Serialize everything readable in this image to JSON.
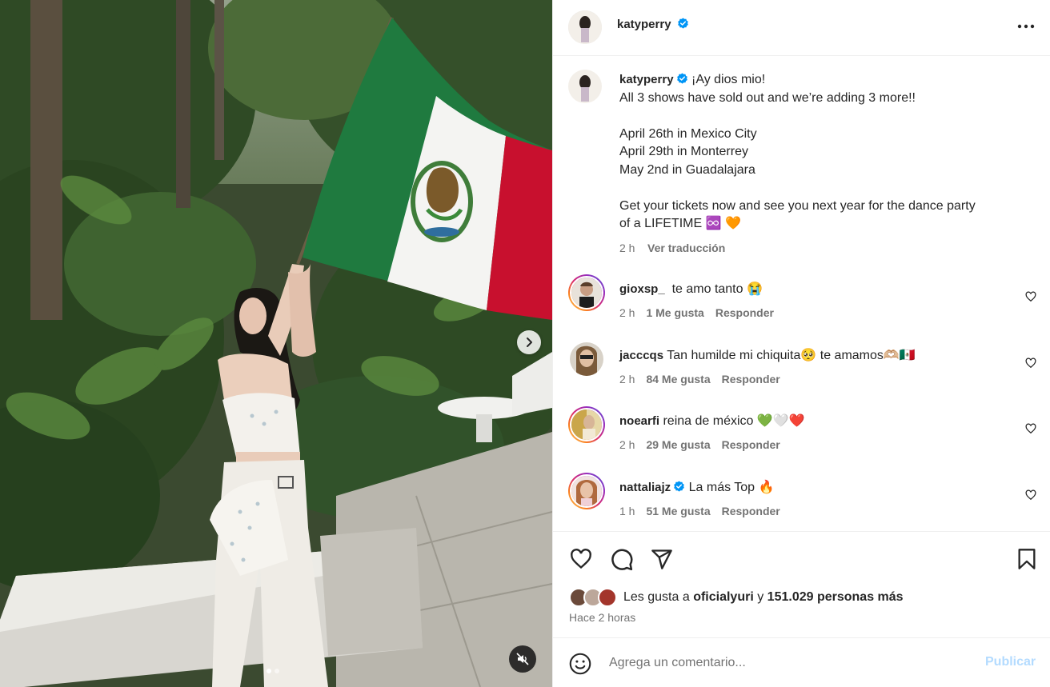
{
  "post": {
    "username": "katyperry",
    "verified_icon": "verified-badge-icon",
    "more_icon": "more-horizontal-icon"
  },
  "caption": {
    "username": "katyperry",
    "lines": [
      "¡Ay dios mio!",
      "All 3 shows have sold out and we’re adding 3 more!!",
      "",
      "April 26th in Mexico City",
      "April 29th in Monterrey",
      "May 2nd in Guadalajara",
      "",
      "Get your tickets now and see you next year for the dance party",
      "of a LIFETIME ♾️ 🧡"
    ],
    "time": "2 h",
    "translate": "Ver traducción"
  },
  "comments": [
    {
      "username": "gioxsp_",
      "text": "te amo tanto 😭",
      "time": "2 h",
      "likes": "1 Me gusta",
      "reply": "Responder",
      "verified": false
    },
    {
      "username": "jacccqs",
      "text": "Tan humilde mi chiquita🥺 te amamos🫶🏼🇲🇽",
      "time": "2 h",
      "likes": "84 Me gusta",
      "reply": "Responder",
      "verified": false
    },
    {
      "username": "noearfi",
      "text": "reina de méxico 💚🤍❤️",
      "time": "2 h",
      "likes": "29 Me gusta",
      "reply": "Responder",
      "verified": false
    },
    {
      "username": "nattaliajz",
      "text": "La más Top 🔥",
      "time": "1 h",
      "likes": "51 Me gusta",
      "reply": "Responder",
      "verified": true
    }
  ],
  "actions": {
    "icons": [
      "heart-icon",
      "comment-icon",
      "share-icon",
      "bookmark-icon"
    ],
    "likes_prefix": "Les gusta a",
    "likes_user": "oficialyuri",
    "likes_connector": "y",
    "likes_rest": "151.029 personas más",
    "posted": "Hace 2 horas"
  },
  "composer": {
    "placeholder": "Agrega un comentario...",
    "publish": "Publicar"
  },
  "media": {
    "carousel_index": 1,
    "carousel_total": 2
  },
  "colors": {
    "accent": "#0095f6",
    "publish_disabled": "#b3dbff",
    "secondary_text": "#737373",
    "flag_green": "#1f7a3f",
    "flag_red": "#c8102e"
  }
}
